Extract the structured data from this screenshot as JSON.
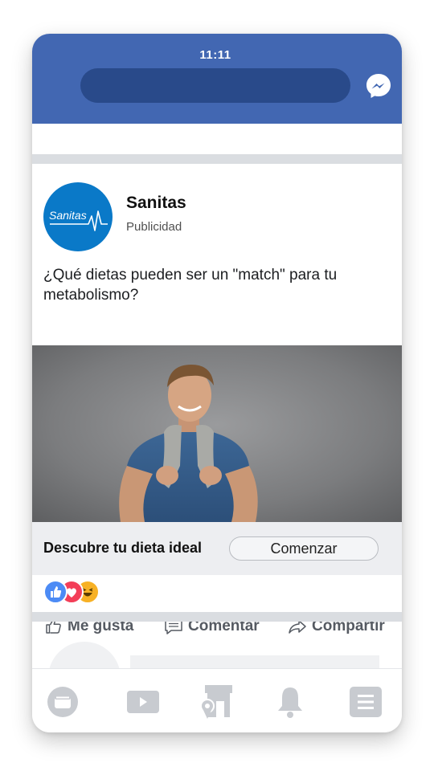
{
  "status_bar": {
    "time": "11:11"
  },
  "header": {
    "search_placeholder": "",
    "messenger_icon": "messenger-icon"
  },
  "post": {
    "brand": {
      "name": "Sanitas",
      "logo_text": "Sanitas"
    },
    "sponsored_label": "Publicidad",
    "text": "¿Qué dietas pueden ser un \"match\" para tu metabolismo?",
    "image_description": "Hombre sonriente con camiseta azul y toalla gris al cuello sobre fondo gris",
    "cta": {
      "headline": "Descubre tu dieta ideal",
      "button_label": "Comenzar"
    },
    "reactions": [
      "like",
      "love",
      "haha"
    ],
    "actions": [
      {
        "label": "Me gusta",
        "icon": "thumbs-up-icon"
      },
      {
        "label": "Comentar",
        "icon": "comment-icon"
      },
      {
        "label": "Compartir",
        "icon": "share-icon"
      }
    ]
  },
  "bottom_nav": [
    {
      "icon": "news-feed-icon"
    },
    {
      "icon": "video-icon"
    },
    {
      "icon": "marketplace-icon"
    },
    {
      "icon": "notifications-icon"
    },
    {
      "icon": "menu-icon"
    }
  ],
  "colors": {
    "facebook_blue": "#4267b2",
    "search_pill": "#294a8a",
    "sanitas_blue": "#0a79c8",
    "separator": "#dadde1",
    "cta_bar": "#edeef1",
    "nav_icon": "#c8cbd0"
  }
}
